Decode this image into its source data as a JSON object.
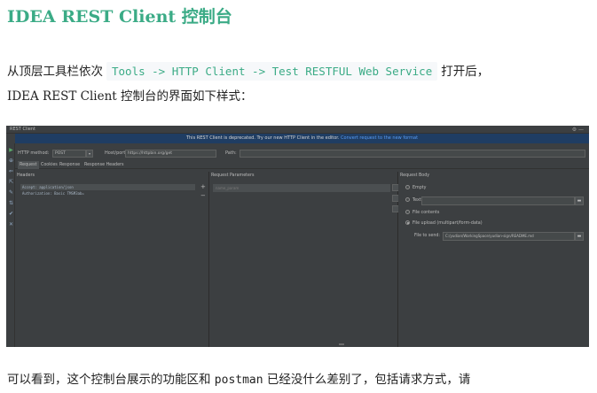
{
  "heading": "IDEA REST Client 控制台",
  "intro": {
    "prefix": "从顶层工具栏依次",
    "menu_path": "Tools -> HTTP Client -> Test RESTFUL Web Service",
    "suffix": "打开后，",
    "line2": "IDEA REST Client 控制台的界面如下样式："
  },
  "outro": {
    "prefix": "可以看到，这个控制台展示的功能区和",
    "code": "postman",
    "suffix": "已经没什么差别了，包括请求方式，请"
  },
  "ide": {
    "window_title": "REST Client",
    "titlebar_icons": "⚙ —",
    "deprecation_text": "This REST Client is deprecated. Try our new HTTP Client in the editor.",
    "deprecation_link": "Convert request to the new format",
    "toolbar_icons": [
      "▶",
      "⊕",
      "⇐",
      "⇱",
      "✎",
      "⇅",
      "✔",
      "✕"
    ],
    "http_method_label": "HTTP method:",
    "http_method_value": "POST",
    "host_label": "Host/port:",
    "host_value": "https://httpbin.org/get",
    "path_label": "Path:",
    "path_value": "",
    "tabs": [
      "Request",
      "Cookies",
      "Response",
      "Response Headers"
    ],
    "headers_title": "Headers",
    "header_lines": [
      "Accept: application/json",
      "Authorization: Basic TMSM3ab="
    ],
    "add_symbol": "+",
    "remove_symbol": "−",
    "params_title": "Request Parameters",
    "params_placeholder": "name_param",
    "body_title": "Request Body",
    "body_options": {
      "empty": "Empty",
      "text": "Text",
      "file_contents": "File contents",
      "file_upload": "File upload (multipart/form-data)"
    },
    "file_to_send_label": "File to send:",
    "file_to_send_value": "C:/yudian/WorkingSpace/yudian-sign/README.md"
  }
}
